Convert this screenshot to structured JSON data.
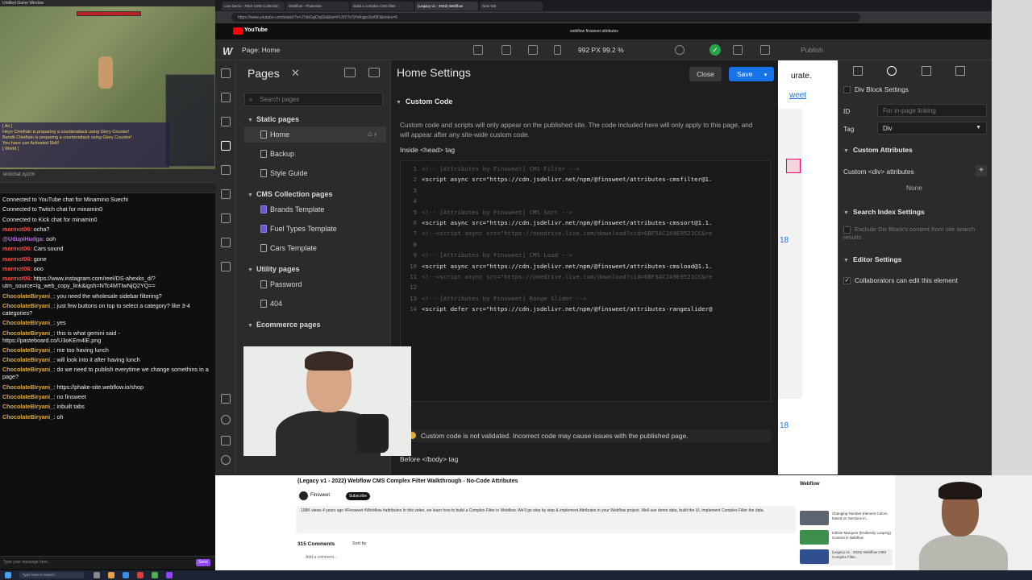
{
  "game": {
    "window_title": "Untitled Game Window",
    "chat_lines": [
      "[ Ali ]",
      "Heyo Chieftain is preparing a counterattack using Glory Counter!",
      "Bandit Chieftain is preparing a counterattack using Glory Counter!",
      "You have use Activated Skill!",
      "[ World ]"
    ]
  },
  "chat": {
    "topbar": "kickchat.xyz/m",
    "messages": [
      {
        "user": "",
        "text": "Connected to YouTube chat for Minamino Suechi",
        "color": "#ffffff"
      },
      {
        "user": "",
        "text": "Connected to Twitch chat for minamin0",
        "color": "#ffffff"
      },
      {
        "user": "",
        "text": "Connected to Kick chat for minamin0",
        "color": "#ffffff"
      },
      {
        "user": "marmot06:",
        "text": "ocha?",
        "color": "#e0544f"
      },
      {
        "user": "@UdupiHudga:",
        "text": "ooh",
        "color": "#b66bd8"
      },
      {
        "user": "marmot06:",
        "text": "Cars sound",
        "color": "#e0544f"
      },
      {
        "user": "marmot06:",
        "text": "gone",
        "color": "#e0544f"
      },
      {
        "user": "marmot06:",
        "text": "ooo",
        "color": "#e0544f"
      },
      {
        "user": "marmot06:",
        "text": "https://www.instagram.com/reel/DS-ahexks_d/?utm_source=ig_web_copy_link&igsh=NTc4MTIwNjQ2YQ==",
        "color": "#e0544f"
      },
      {
        "user": "ChocolateBiryani_:",
        "text": "you need the wholesale sidebar filtering?",
        "color": "#d9a94d"
      },
      {
        "user": "ChocolateBiryani_:",
        "text": "just few buttons on top to select a category? like 3-4 categories?",
        "color": "#d9a94d"
      },
      {
        "user": "ChocolateBiryani_:",
        "text": "yes",
        "color": "#d9a94d"
      },
      {
        "user": "ChocolateBiryani_:",
        "text": "this is what gemini said - https://pasteboard.co/U3oKEm4lE.png",
        "color": "#d9a94d"
      },
      {
        "user": "ChocolateBiryani_:",
        "text": "me too having lunch",
        "color": "#d9a94d"
      },
      {
        "user": "ChocolateBiryani_:",
        "text": "will look into it after having lunch",
        "color": "#d9a94d"
      },
      {
        "user": "ChocolateBiryani_:",
        "text": "do we need to publish everytime we change somethins in a page?",
        "color": "#d9a94d"
      },
      {
        "user": "ChocolateBiryani_:",
        "text": "https://phake-site.webflow.io/shop",
        "color": "#d9a94d"
      },
      {
        "user": "ChocolateBiryani_:",
        "text": "no finsweet",
        "color": "#d9a94d"
      },
      {
        "user": "ChocolateBiryani_:",
        "text": "inbuilt tabs",
        "color": "#d9a94d"
      },
      {
        "user": "ChocolateBiryani_:",
        "text": "oh",
        "color": "#d9a94d"
      }
    ],
    "input_placeholder": "Type your message here...",
    "send_label": "Send"
  },
  "browser": {
    "tabs": [
      "Live Demo - Filter CMS Collection",
      "Webflow - Phakesite",
      "Build a complex CMS filter",
      "(Legacy v1 - 2022) Webflow",
      "New Tab"
    ],
    "url": "https://www.youtube.com/watch?v=J7obGgCtqGk&list=PLNY7e7jYvKqpsSzrl9O&index=5"
  },
  "youtube": {
    "logo": "YouTube",
    "search_text": "webflow finsweet attributes"
  },
  "webflow": {
    "logo": "W",
    "page_label": "Page: Home",
    "viewport": "992 PX  99.2 %",
    "publish_label": "Publish",
    "pages_panel": {
      "title": "Pages",
      "search_placeholder": "Search pages",
      "groups": [
        {
          "label": "Static pages",
          "items": [
            {
              "label": "Home",
              "selected": true,
              "cms": false
            },
            {
              "label": "Backup",
              "cms": false
            },
            {
              "label": "Style Guide",
              "cms": false
            }
          ]
        },
        {
          "label": "CMS Collection pages",
          "items": [
            {
              "label": "Brands Template",
              "cms": true
            },
            {
              "label": "Fuel Types Template",
              "cms": true
            },
            {
              "label": "Cars Template",
              "cms": false
            }
          ]
        },
        {
          "label": "Utility pages",
          "items": [
            {
              "label": "Password",
              "cms": false
            },
            {
              "label": "404",
              "cms": false
            }
          ]
        },
        {
          "label": "Ecommerce pages",
          "items": []
        }
      ]
    },
    "settings": {
      "title": "Home Settings",
      "close_label": "Close",
      "save_label": "Save",
      "section": "Custom Code",
      "description": "Custom code and scripts will only appear on the published site. The code included here will only apply to this page, and will appear after any site-wide custom code.",
      "head_label": "Inside <head> tag",
      "code_lines": [
        {
          "n": "1",
          "text": "<!-- [Attributes by Finsweet] CMS Filter -->",
          "comment": true
        },
        {
          "n": "2",
          "text": "<script async src=\"https://cdn.jsdelivr.net/npm/@finsweet/attributes-cmsfilter@1.",
          "comment": false
        },
        {
          "n": "3",
          "text": "",
          "comment": false
        },
        {
          "n": "4",
          "text": "",
          "comment": false
        },
        {
          "n": "5",
          "text": "<!-- [Attributes by Finsweet] CMS Sort -->",
          "comment": true
        },
        {
          "n": "6",
          "text": "<script async src=\"https://cdn.jsdelivr.net/npm/@finsweet/attributes-cmssort@1.1.",
          "comment": false
        },
        {
          "n": "7",
          "text": "<!--<script async src=\"https://onedrive.live.com/download?cid=6BF5AC2A9E9521CC&re",
          "comment": true
        },
        {
          "n": "8",
          "text": "",
          "comment": false
        },
        {
          "n": "9",
          "text": "<!-- [Attributes by Finsweet] CMS Load -->",
          "comment": true
        },
        {
          "n": "10",
          "text": "<script async src=\"https://cdn.jsdelivr.net/npm/@finsweet/attributes-cmsload@1.1.",
          "comment": false
        },
        {
          "n": "11",
          "text": "<!--<script async src=\"https://onedrive.live.com/download?cid=6BF5AC2A9E9521CC&re",
          "comment": true
        },
        {
          "n": "12",
          "text": "",
          "comment": false
        },
        {
          "n": "13",
          "text": "<!-- [Attributes by Finsweet] Range Slider -->",
          "comment": true
        },
        {
          "n": "14",
          "text": "<script defer src=\"https://cdn.jsdelivr.net/npm/@finsweet/attributes-rangeslider@",
          "comment": false
        }
      ],
      "warning": "Custom code is not validated. Incorrect code may cause issues with the published page.",
      "body_label": "Before </body> tag"
    },
    "canvas": {
      "text1": "urate.",
      "text2": "weet",
      "num1": "18",
      "num2": "18"
    },
    "right_panel": {
      "block_settings": "Div Block Settings",
      "id_label": "ID",
      "id_placeholder": "For in-page linking",
      "tag_label": "Tag",
      "tag_value": "Div",
      "custom_attrs": "Custom Attributes",
      "custom_attrs_label": "Custom <div> attributes",
      "none": "None",
      "search_index": "Search Index Settings",
      "exclude_text": "Exclude Div Block's content from site search results",
      "editor_settings": "Editor Settings",
      "collab_text": "Collaborators can edit this element"
    }
  },
  "video": {
    "title": "(Legacy v1 - 2022) Webflow CMS Complex Filter Walkthrough - No-Code Attributes",
    "channel": "Finsweet",
    "subscribe": "Subscribe",
    "description": "108K views 4 years ago #Finsweet #Webflow #attributes  In this video, we learn how to build a Complex Filter in Webflow. We'll go step by step & implement Attributes in your Webflow project. Well use demo data, build the UI, implement Complex Filter the data.",
    "comments": "315 Comments",
    "sort": "Sort by",
    "add_comment": "Add a comment...",
    "sidebar_title": "Webflow",
    "related": [
      "Changing Number Element Colors based on Sections in...",
      "Infinite Marquee (Endlessly Looping) Content in Webflow",
      "(Legacy v1 - 2022) Webflow CMS Complex Filter..."
    ]
  },
  "taskbar": {
    "search": "Type here to search"
  }
}
